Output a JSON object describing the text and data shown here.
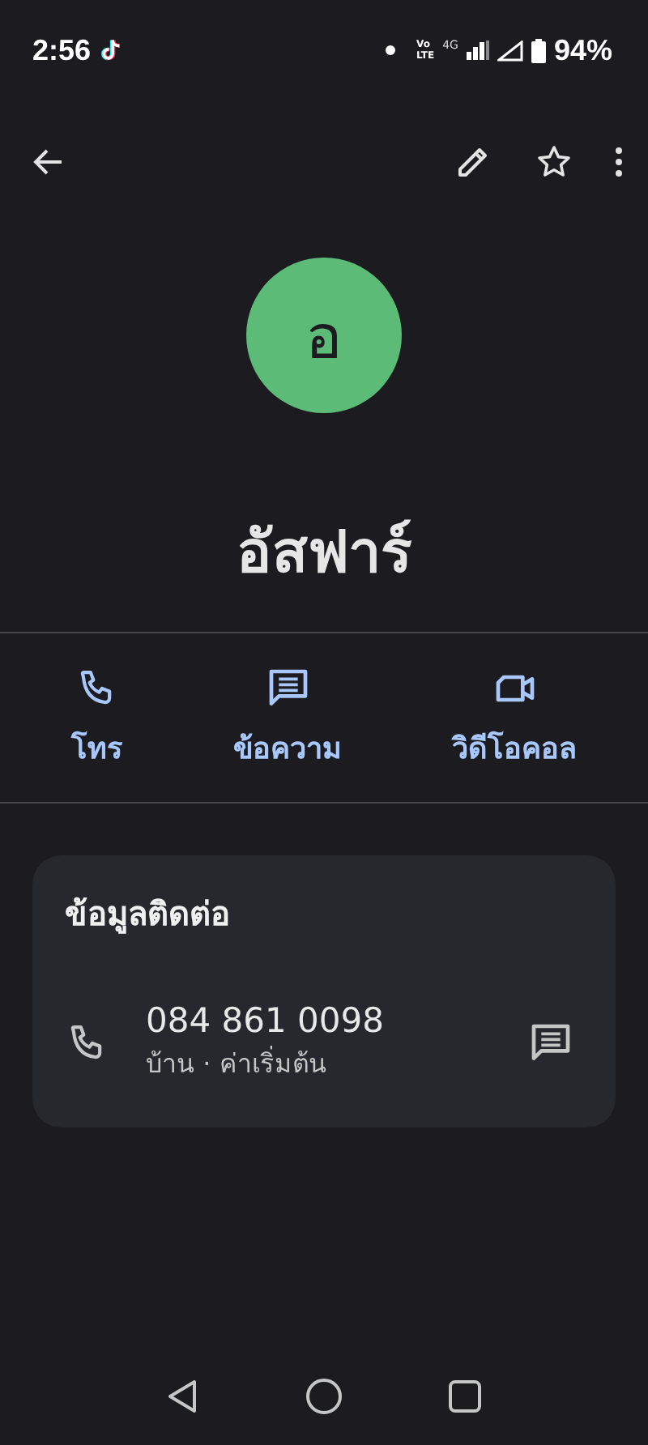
{
  "status_bar": {
    "time": "2:56",
    "volte_top": "Vo",
    "volte_bottom": "LTE",
    "network": "4G",
    "battery": "94%"
  },
  "contact": {
    "initial": "อ",
    "name": "อัสฟาร์"
  },
  "actions": [
    {
      "kind": "call",
      "label": "โทร"
    },
    {
      "kind": "message",
      "label": "ข้อความ"
    },
    {
      "kind": "video",
      "label": "วิดีโอคอล"
    }
  ],
  "info_card": {
    "title": "ข้อมูลติดต่อ",
    "phone": "084 861 0098",
    "detail": "บ้าน · ค่าเริ่มต้น"
  }
}
